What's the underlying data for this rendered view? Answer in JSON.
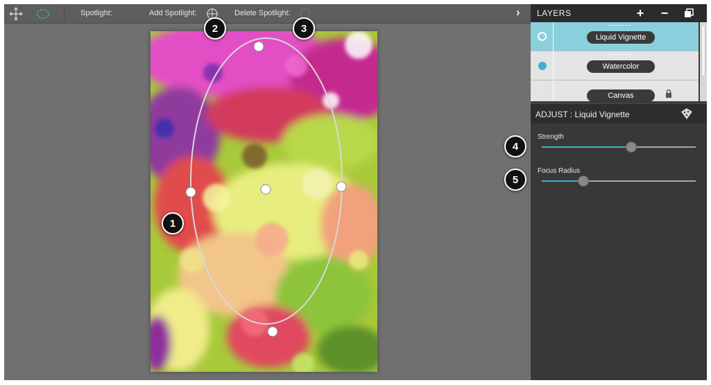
{
  "toolbar": {
    "move_icon": "move-arrows-icon",
    "ellipse_icon": "ellipse-select-icon",
    "spotlight_label": "Spotlight:",
    "add_spotlight_label": "Add Spotlight:",
    "delete_spotlight_label": "Delete Spotlight:",
    "collapse_icon": "chevron-right-icon"
  },
  "callouts": [
    "1",
    "2",
    "3",
    "4",
    "5"
  ],
  "layers": {
    "title": "LAYERS",
    "add_label": "+",
    "remove_label": "−",
    "items": [
      {
        "name": "Liquid Vignette",
        "active": true
      },
      {
        "name": "Watercolor",
        "active": false
      },
      {
        "name": "Canvas",
        "active": false,
        "locked": true
      }
    ]
  },
  "adjust": {
    "title": "ADJUST : Liquid Vignette",
    "sliders": [
      {
        "label": "Strength",
        "value": 0.58
      },
      {
        "label": "Focus Radius",
        "value": 0.27
      }
    ]
  },
  "colors": {
    "accent": "#3bb5c8",
    "active_layer": "#89d0dc",
    "panel": "#383838",
    "canvas": "#707070"
  }
}
